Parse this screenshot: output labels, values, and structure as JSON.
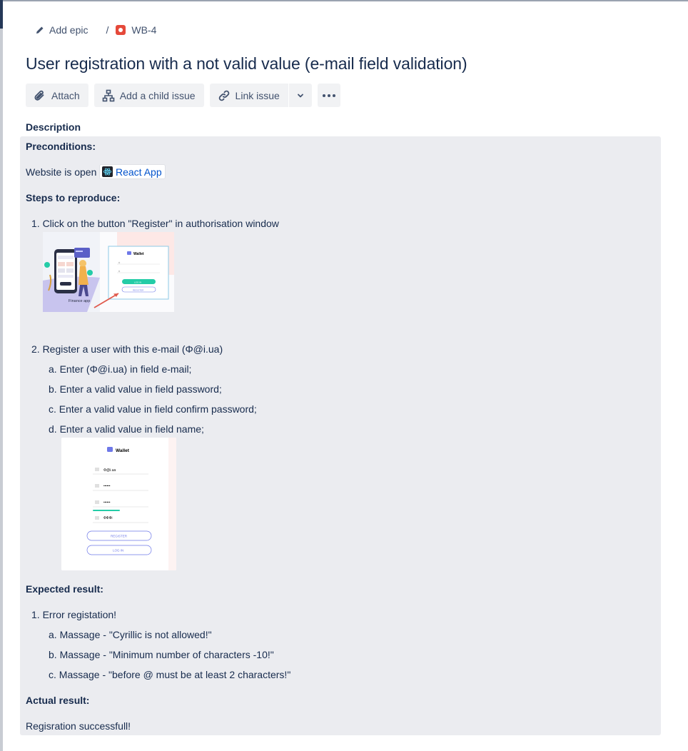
{
  "breadcrumbs": {
    "epic_label": "Add epic",
    "separator": "/",
    "issue_key": "WB-4"
  },
  "issue": {
    "title": "User registration with a not valid value (e-mail field validation)"
  },
  "toolbar": {
    "attach": "Attach",
    "add_child": "Add a child issue",
    "link_issue": "Link issue"
  },
  "description": {
    "label": "Description",
    "preconditions_heading": "Preconditions:",
    "website_text": "Website is open",
    "link_text": "React App",
    "steps_heading": "Steps to reproduce:",
    "step1": "1. Click on the button \"Register\" in authorisation window",
    "step2": "2. Register a user with this e-mail (Φ@i.ua)",
    "step2a": "a. Enter (Φ@i.ua) in  field e-mail;",
    "step2b": "b. Enter a valid value in field password;",
    "step2c": "c. Enter a valid value in field confirm password;",
    "step2d": "d. Enter a valid value in  field name;",
    "expected_heading": "Expected result:",
    "exp1": "1. Error registation!",
    "exp1a": "a. Massage - \"Cyrillic is not allowed!\"",
    "exp1b": "b. Massage - \"Minimum number of characters -10!\"",
    "exp1c": "c. Massage - \"before  @  must be at least 2 characters!\"",
    "actual_heading": "Actual result:",
    "actual_text": "Regisration successfull!"
  },
  "screenshot1": {
    "wallet_title": "Wallet",
    "finance_caption": "Finance app",
    "login_btn": "LOG IN",
    "register_btn": "REGISTER"
  },
  "screenshot2": {
    "wallet_title": "Wallet",
    "email_value": "Φ@i.ua",
    "password_value": "••••••",
    "confirm_value": "••••••",
    "name_value": "ФФФі",
    "register_btn": "REGISTER",
    "login_btn": "LOG IN"
  },
  "colors": {
    "bug_icon": "#e5493a",
    "link": "#0052cc",
    "description_bg": "#ebecf0",
    "button_bg": "#f1f2f4"
  },
  "icons": [
    "pencil-icon",
    "bug-icon",
    "paperclip-icon",
    "hierarchy-icon",
    "link-icon",
    "chevron-down-icon",
    "more-icon",
    "react-icon",
    "wallet-icon"
  ]
}
